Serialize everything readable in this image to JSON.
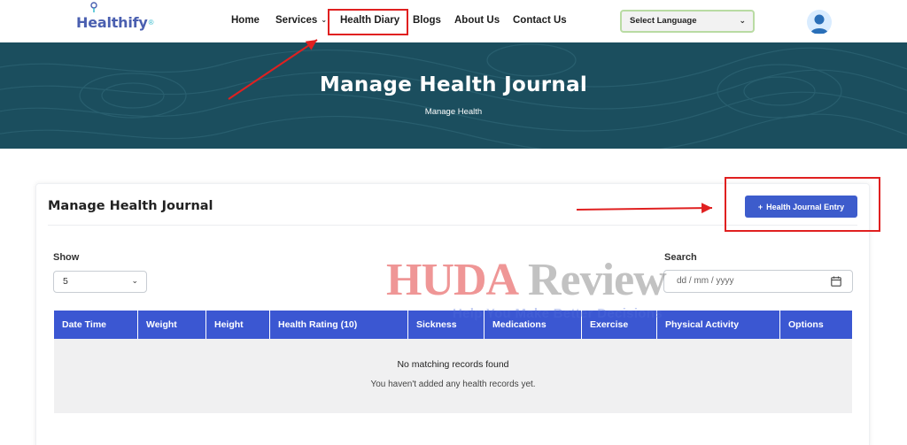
{
  "brand": {
    "name": "Healthify",
    "mark": "®"
  },
  "nav": {
    "items": [
      {
        "label": "Home"
      },
      {
        "label": "Services",
        "has_dropdown": true
      },
      {
        "label": "Health Diary",
        "highlighted": true
      },
      {
        "label": "Blogs"
      },
      {
        "label": "About Us"
      },
      {
        "label": "Contact Us"
      }
    ],
    "language_select": "Select Language"
  },
  "hero": {
    "title": "Manage Health Journal",
    "subtitle": "Manage Health"
  },
  "card": {
    "title": "Manage Health Journal",
    "add_button": "Health Journal Entry",
    "show_label": "Show",
    "show_value": "5",
    "search_label": "Search",
    "search_placeholder": "dd / mm / yyyy"
  },
  "table": {
    "columns": [
      "Date Time",
      "Weight",
      "Height",
      "Health Rating (10)",
      "Sickness",
      "Medications",
      "Exercise",
      "Physical Activity",
      "Options"
    ],
    "empty_title": "No matching records found",
    "empty_message": "You haven't added any health records yet."
  },
  "watermark": {
    "brand_a": "HUDA",
    "brand_b": "Review",
    "tagline": "Help You Make Better Decisions"
  },
  "colors": {
    "brand_blue": "#3d5ccc",
    "table_header": "#3b57d2",
    "hero_bg": "#1b4e5e",
    "annotation_red": "#e02020"
  }
}
